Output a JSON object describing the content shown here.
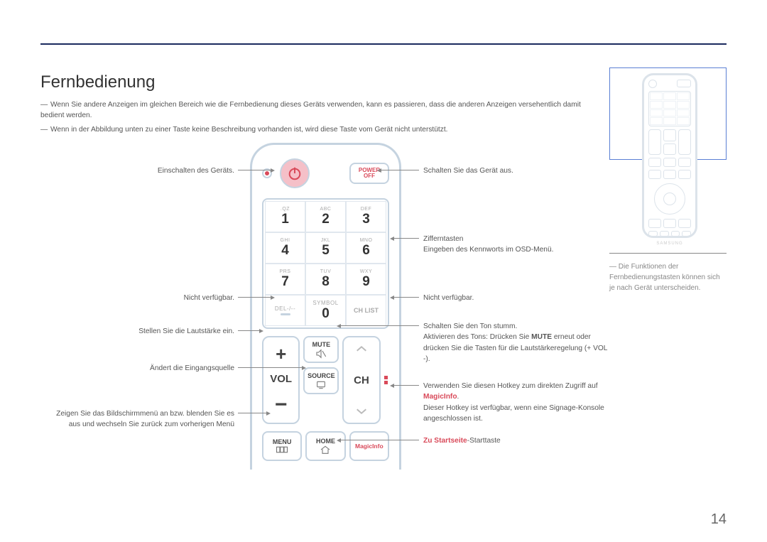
{
  "title": "Fernbedienung",
  "notes": {
    "n1": "Wenn Sie andere Anzeigen im gleichen Bereich wie die Fernbedienung dieses Geräts verwenden, kann es passieren, dass die anderen Anzeigen versehentlich damit bedient werden.",
    "n2": "Wenn in der Abbildung unten zu einer Taste keine Beschreibung vorhanden ist, wird diese Taste vom Gerät nicht unterstützt."
  },
  "remote": {
    "poweroff1": "POWER",
    "poweroff2": "OFF",
    "keys": [
      [
        {
          "sub": ".QZ",
          "main": "1"
        },
        {
          "sub": "ABC",
          "main": "2"
        },
        {
          "sub": "DEF",
          "main": "3"
        }
      ],
      [
        {
          "sub": "GHI",
          "main": "4"
        },
        {
          "sub": "JKL",
          "main": "5"
        },
        {
          "sub": "MNO",
          "main": "6"
        }
      ],
      [
        {
          "sub": "PRS",
          "main": "7"
        },
        {
          "sub": "TUV",
          "main": "8"
        },
        {
          "sub": "WXY",
          "main": "9"
        }
      ]
    ],
    "del": "DEL-/--",
    "symbol": "SYMBOL",
    "zero": "0",
    "chlist": "CH LIST",
    "vol": "VOL",
    "ch": "CH",
    "mute": "MUTE",
    "source": "SOURCE",
    "menu": "MENU",
    "home": "HOME",
    "magicinfo": "MagicInfo"
  },
  "callouts": {
    "l_poweron": "Einschalten des Geräts.",
    "l_na": "Nicht verfügbar.",
    "l_vol": "Stellen Sie die Lautstärke ein.",
    "l_source": "Ändert die Eingangsquelle",
    "l_menu": "Zeigen Sie das Bildschirmmenü an bzw. blenden Sie es aus und wechseln Sie zurück zum vorherigen Menü",
    "r_poweroff": "Schalten Sie das Gerät aus.",
    "r_num": "Zifferntasten",
    "r_num2": "Eingeben des Kennworts im OSD-Menü.",
    "r_na": "Nicht verfügbar.",
    "r_mute1": "Schalten Sie den Ton stumm.",
    "r_mute2a": "Aktivieren des Tons: Drücken Sie ",
    "r_mute2b": "MUTE",
    "r_mute2c": " erneut oder drücken Sie die Tasten für die Lautstärkeregelung (+ VOL -).",
    "r_magic1": "Verwenden Sie diesen Hotkey zum direkten Zugriff auf ",
    "r_magic_link": "MagicInfo",
    "r_magic2": "Dieser Hotkey ist verfügbar, wenn eine Signage-Konsole angeschlossen ist.",
    "r_home1": "Zu Startseite",
    "r_home2": "-Starttaste"
  },
  "side": "Die Funktionen der Fernbedienungstasten können sich je nach Gerät unterscheiden.",
  "brand": "SAMSUNG",
  "pagenum": "14"
}
